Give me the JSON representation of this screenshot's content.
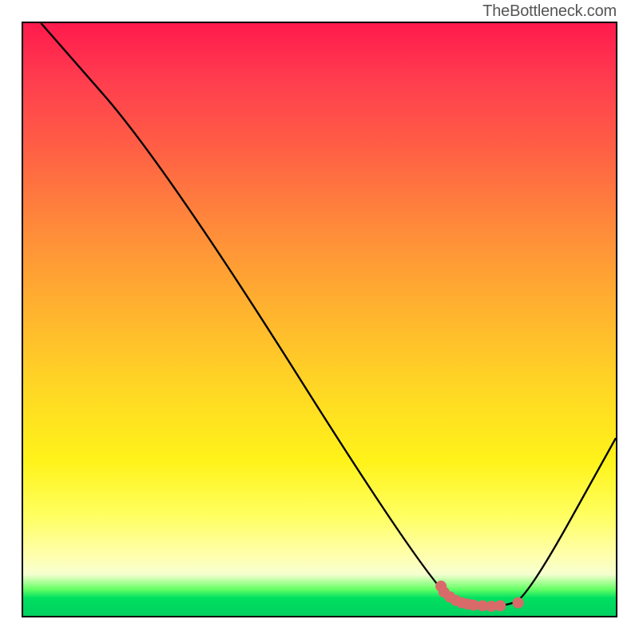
{
  "attribution": "TheBottleneck.com",
  "colors": {
    "border": "#000000",
    "marker": "#d96a6a",
    "curve": "#000000"
  },
  "chart_data": {
    "type": "line",
    "title": "",
    "xlabel": "",
    "ylabel": "",
    "xlim": [
      0,
      100
    ],
    "ylim": [
      0,
      100
    ],
    "grid": false,
    "legend": false,
    "background": "rainbow-vertical",
    "curve_xy": [
      [
        3,
        100
      ],
      [
        24,
        76
      ],
      [
        70,
        3
      ],
      [
        76,
        1.5
      ],
      [
        81,
        1.6
      ],
      [
        85,
        3
      ],
      [
        100,
        30
      ]
    ],
    "markers_xy": [
      [
        70.5,
        5.0
      ],
      [
        71.0,
        4.0
      ],
      [
        72.0,
        3.2
      ],
      [
        73.0,
        2.6
      ],
      [
        74.0,
        2.2
      ],
      [
        75.0,
        2.0
      ],
      [
        76.0,
        1.8
      ],
      [
        77.5,
        1.7
      ],
      [
        79.0,
        1.6
      ],
      [
        80.5,
        1.7
      ],
      [
        83.5,
        2.2
      ]
    ],
    "marker_radius_px": 7
  }
}
